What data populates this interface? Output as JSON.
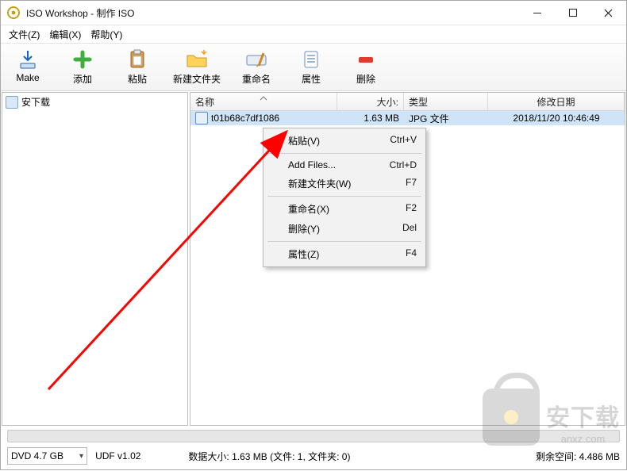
{
  "title": "ISO Workshop - 制作 ISO",
  "menu": {
    "file": "文件(Z)",
    "edit": "编辑(X)",
    "help": "帮助(Y)"
  },
  "toolbar": {
    "make": "Make",
    "add": "添加",
    "paste": "粘贴",
    "newfolder": "新建文件夹",
    "rename": "重命名",
    "props": "属性",
    "delete": "删除"
  },
  "tree": {
    "root": "安下载"
  },
  "columns": {
    "name": "名称",
    "size": "大小:",
    "type": "类型",
    "date": "修改日期"
  },
  "rows": [
    {
      "name": "t01b68c7df1086",
      "size": "1.63 MB",
      "type": "JPG 文件",
      "date": "2018/11/20 10:46:49"
    }
  ],
  "context": {
    "paste": {
      "label": "粘贴(V)",
      "shortcut": "Ctrl+V"
    },
    "addfiles": {
      "label": "Add Files...",
      "shortcut": "Ctrl+D"
    },
    "newfolder": {
      "label": "新建文件夹(W)",
      "shortcut": "F7"
    },
    "rename": {
      "label": "重命名(X)",
      "shortcut": "F2"
    },
    "delete": {
      "label": "删除(Y)",
      "shortcut": "Del"
    },
    "props": {
      "label": "属性(Z)",
      "shortcut": "F4"
    }
  },
  "disc": {
    "selected": "DVD 4.7 GB",
    "fs": "UDF v1.02"
  },
  "stats": {
    "data": "数据大小: 1.63 MB (文件: 1, 文件夹: 0)",
    "free": "剩余空间: 4.486 MB"
  },
  "watermark": {
    "text": "安下载",
    "url": "anxz.com"
  }
}
